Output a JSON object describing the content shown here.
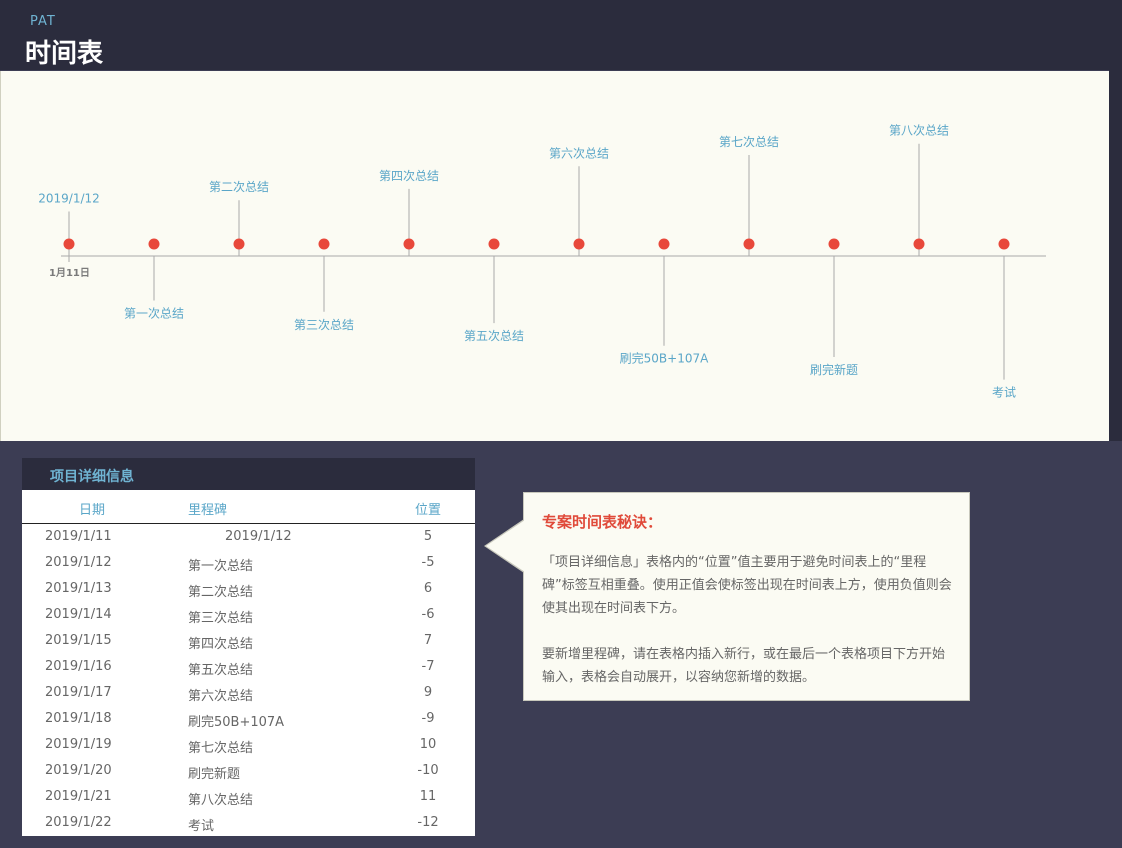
{
  "header": {
    "subtitle": "PAT",
    "title": "时间表"
  },
  "timeline": {
    "start_label": "1月11日",
    "milestones": [
      {
        "label": "2019/1/12",
        "pos": 5
      },
      {
        "label": "第一次总结",
        "pos": -5
      },
      {
        "label": "第二次总结",
        "pos": 6
      },
      {
        "label": "第三次总结",
        "pos": -6
      },
      {
        "label": "第四次总结",
        "pos": 7
      },
      {
        "label": "第五次总结",
        "pos": -7
      },
      {
        "label": "第六次总结",
        "pos": 9
      },
      {
        "label": "刷完50B+107A",
        "pos": -9
      },
      {
        "label": "第七次总结",
        "pos": 10
      },
      {
        "label": "刷完新题",
        "pos": -10
      },
      {
        "label": "第八次总结",
        "pos": 11
      },
      {
        "label": "考试",
        "pos": -12
      }
    ],
    "colors": {
      "dot": "#e8483a",
      "axis": "#a9a9a9",
      "label": "#5aa6c8"
    }
  },
  "table": {
    "title": "项目详细信息",
    "columns": [
      "日期",
      "里程碑",
      "位置"
    ],
    "rows": [
      [
        "2019/1/11",
        "2019/1/12",
        "5"
      ],
      [
        "2019/1/12",
        "第一次总结",
        "-5"
      ],
      [
        "2019/1/13",
        "第二次总结",
        "6"
      ],
      [
        "2019/1/14",
        "第三次总结",
        "-6"
      ],
      [
        "2019/1/15",
        "第四次总结",
        "7"
      ],
      [
        "2019/1/16",
        "第五次总结",
        "-7"
      ],
      [
        "2019/1/17",
        "第六次总结",
        "9"
      ],
      [
        "2019/1/18",
        "刷完50B+107A",
        "-9"
      ],
      [
        "2019/1/19",
        "第七次总结",
        "10"
      ],
      [
        "2019/1/20",
        "刷完新题",
        "-10"
      ],
      [
        "2019/1/21",
        "第八次总结",
        "11"
      ],
      [
        "2019/1/22",
        "考试",
        "-12"
      ]
    ]
  },
  "tip": {
    "title": "专案时间表秘诀：",
    "p1": "「项目详细信息」表格内的“位置”值主要用于避免时间表上的“里程碑”标签互相重叠。使用正值会使标签出现在时间表上方，使用负值则会使其出现在时间表下方。",
    "p2": "要新增里程碑，请在表格内插入新行，或在最后一个表格项目下方开始输入，表格会自动展开，以容纳您新增的数据。"
  }
}
